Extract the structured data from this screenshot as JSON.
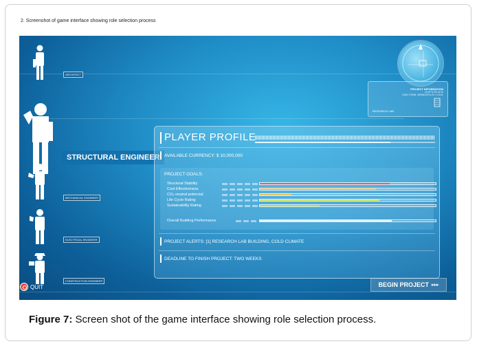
{
  "figure_label": "2.  Screenshot of game interface showing role selection process",
  "roles": [
    {
      "label": "ARCHITECT"
    },
    {
      "label": "STRUCTURAL ENGINEER"
    },
    {
      "label": "MECHANICAL ENGINEER"
    },
    {
      "label": "ELECTRICAL ENGINEER"
    },
    {
      "label": "CONSTRUCTION ENGINEER"
    }
  ],
  "selected_role": "STRUCTURAL ENGINEER",
  "project_info": {
    "title": "PROJECT INFORMATION",
    "coords": "44.97°N  93.16°W",
    "location": "DWN TOWN, MINNEAPOLIS  //  COOL",
    "building": "RESEARCH LAB"
  },
  "player_profile": {
    "title": "PLAYER PROFILE",
    "currency": "AVAILABLE CURRENCY:  $ 10,000,000",
    "goals_header": "PROJECT GOALS:",
    "goals": [
      {
        "label": "Structural Stability",
        "value": 0.74,
        "color": "#e05a6a"
      },
      {
        "label": "Cost Effectiveness",
        "value": 0.66,
        "color": "#e9b85a"
      },
      {
        "label": "CO₂-neutral potencial",
        "value": 0.18,
        "color": "#e8c15c"
      },
      {
        "label": "Life Cycle Rating",
        "value": 0.68,
        "color": "#c6e05a"
      },
      {
        "label": "Sustainability Rating",
        "value": 0.34,
        "color": "#a7d85e"
      }
    ],
    "overall_label": "Overall Building Performance",
    "overall_value": 0.75,
    "alerts": "PROJECT ALERTS: [1] RESEARCH LAB  BUILDING, COLD CLIMATE",
    "deadline": "DEADLINE TO FINISH PROJECT:  TWO WEEKS"
  },
  "buttons": {
    "quit": "QUIT",
    "begin": "BEGIN PROJECT",
    "begin_arrows": "▸▸▸"
  },
  "caption": {
    "bold": "Figure 7:",
    "text": " Screen shot of the game interface showing role selection process."
  }
}
